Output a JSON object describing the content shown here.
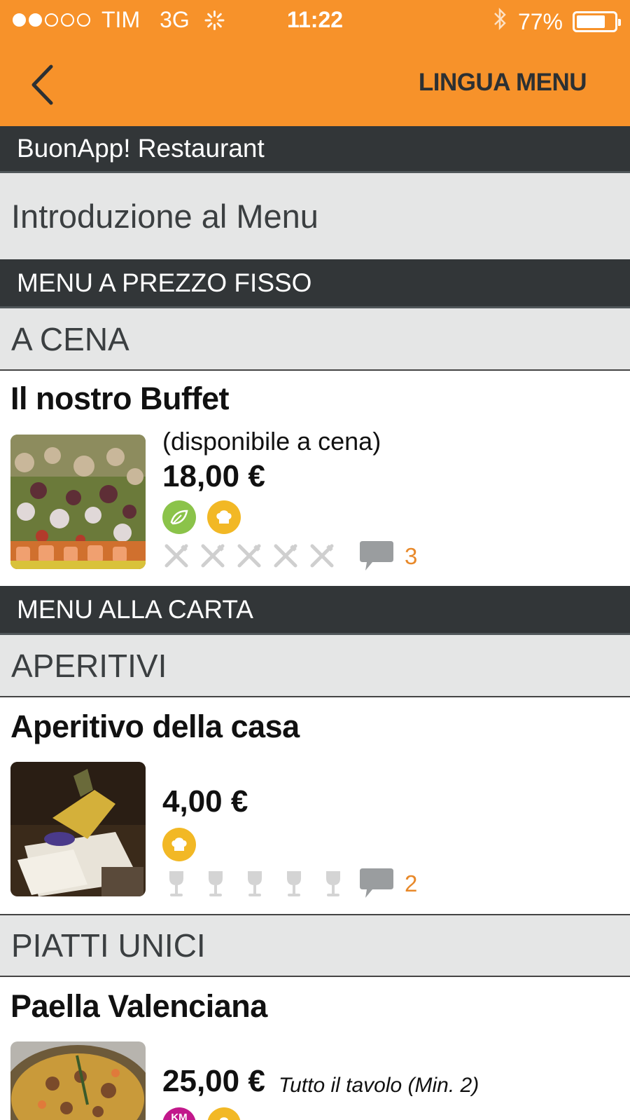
{
  "status_bar": {
    "carrier": "TIM",
    "network": "3G",
    "time": "11:22",
    "battery": "77%",
    "signal_bars_filled": 2,
    "signal_bars_total": 5,
    "battery_level": 0.77
  },
  "nav": {
    "back_icon": "chevron-left-icon",
    "language_button": "LINGUA MENU"
  },
  "restaurant_name": "BuonApp! Restaurant",
  "intro_link": "Introduzione al Menu",
  "colors": {
    "header": "#f7922a",
    "dark_bar": "#323638",
    "category_bg": "#e5e6e6",
    "comment_count": "#e8892a",
    "organic_badge": "#8bc34a",
    "chef_badge": "#f2b825",
    "km_badge": "#c2188b"
  },
  "sections": [
    {
      "title": "MENU A PREZZO FISSO",
      "categories": [
        {
          "title": "A CENA",
          "items": [
            {
              "name": "Il nostro Buffet",
              "description": "(disponibile a cena)",
              "price": "18,00 €",
              "badges": [
                "organic-leaf-icon",
                "chef-hat-icon"
              ],
              "rating_icon": "fork-knife-icon",
              "rating_max": 5,
              "comment_count": "3"
            }
          ]
        }
      ]
    },
    {
      "title": "MENU ALLA CARTA",
      "categories": [
        {
          "title": "APERITIVI",
          "items": [
            {
              "name": "Aperitivo della casa",
              "price": "4,00 €",
              "badges": [
                "chef-hat-icon"
              ],
              "rating_icon": "wine-glass-icon",
              "rating_max": 5,
              "comment_count": "2"
            }
          ]
        },
        {
          "title": "PIATTI UNICI",
          "items": [
            {
              "name": "Paella Valenciana",
              "price": "25,00 €",
              "price_note": "Tutto il tavolo (Min. 2)",
              "badges": [
                "km-zero-icon",
                "chef-hat-icon"
              ],
              "km_badge_text": "KM"
            }
          ]
        }
      ]
    }
  ]
}
